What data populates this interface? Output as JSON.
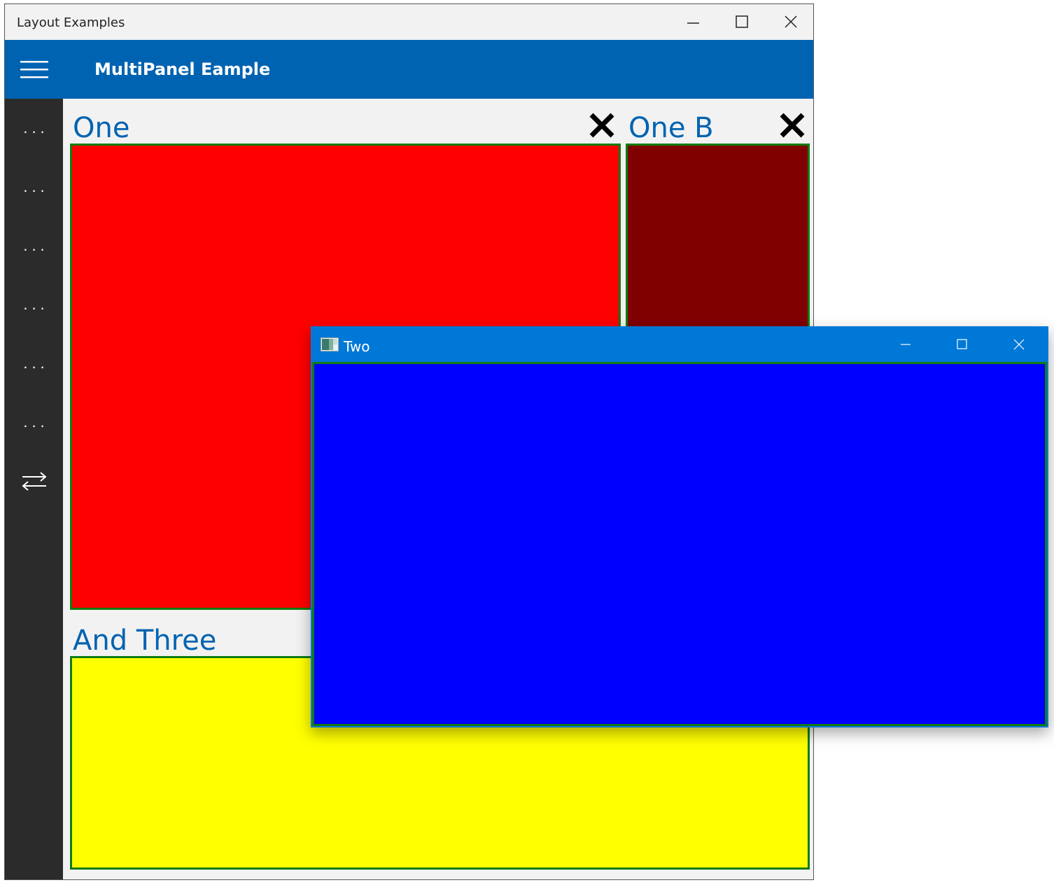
{
  "main_window": {
    "title": "Layout Examples",
    "controls": [
      "minimize",
      "maximize",
      "close"
    ]
  },
  "app_bar": {
    "title": "MultiPanel Eample",
    "background": "#0063b1"
  },
  "nav_rail": {
    "items": [
      {
        "label": "...",
        "icon": "more-icon"
      },
      {
        "label": "...",
        "icon": "more-icon"
      },
      {
        "label": "...",
        "icon": "more-icon"
      },
      {
        "label": "...",
        "icon": "more-icon"
      },
      {
        "label": "...",
        "icon": "more-icon"
      },
      {
        "label": "...",
        "icon": "more-icon"
      },
      {
        "label": "",
        "icon": "swap-arrows-icon"
      }
    ]
  },
  "panels": {
    "one": {
      "title": "One",
      "color": "#ff0000"
    },
    "one_b": {
      "title": "One B",
      "color": "#800000"
    },
    "three": {
      "title": "And Three",
      "color": "#ffff00"
    }
  },
  "floating_window": {
    "title": "Two",
    "body_color": "#0000ff",
    "border_color": "#107c10"
  },
  "colors": {
    "accent": "#0063b1",
    "panel_title": "#0063b1",
    "panel_border": "#107c10"
  }
}
